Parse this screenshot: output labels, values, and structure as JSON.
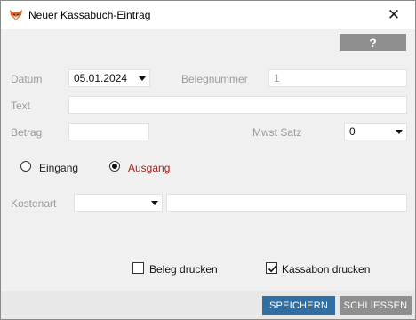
{
  "window": {
    "title": "Neuer Kassabuch-Eintrag",
    "app_icon": "fox-icon",
    "close_glyph": "✕"
  },
  "toolbar": {
    "help_label": "?"
  },
  "form": {
    "datum": {
      "label": "Datum",
      "value": "05.01.2024"
    },
    "belegnummer": {
      "label": "Belegnummer",
      "value": "1"
    },
    "text": {
      "label": "Text",
      "value": ""
    },
    "betrag": {
      "label": "Betrag",
      "value": ""
    },
    "mwst": {
      "label": "Mwst Satz",
      "value": "0"
    },
    "direction": {
      "eingang": {
        "label": "Eingang",
        "selected": false
      },
      "ausgang": {
        "label": "Ausgang",
        "selected": true
      }
    },
    "kostenart": {
      "label": "Kostenart",
      "value": "",
      "detail": ""
    }
  },
  "options": {
    "beleg_drucken": {
      "label": "Beleg drucken",
      "checked": false
    },
    "kassabon_drucken": {
      "label": "Kassabon drucken",
      "checked": true
    }
  },
  "footer": {
    "save_label": "SPEICHERN",
    "close_label": "SCHLIESSEN"
  },
  "colors": {
    "primary_button": "#2f6fa3",
    "secondary_button": "#8f8f8f",
    "active_radio_label": "#b01e1e",
    "label_gray": "#9b9b9b"
  }
}
